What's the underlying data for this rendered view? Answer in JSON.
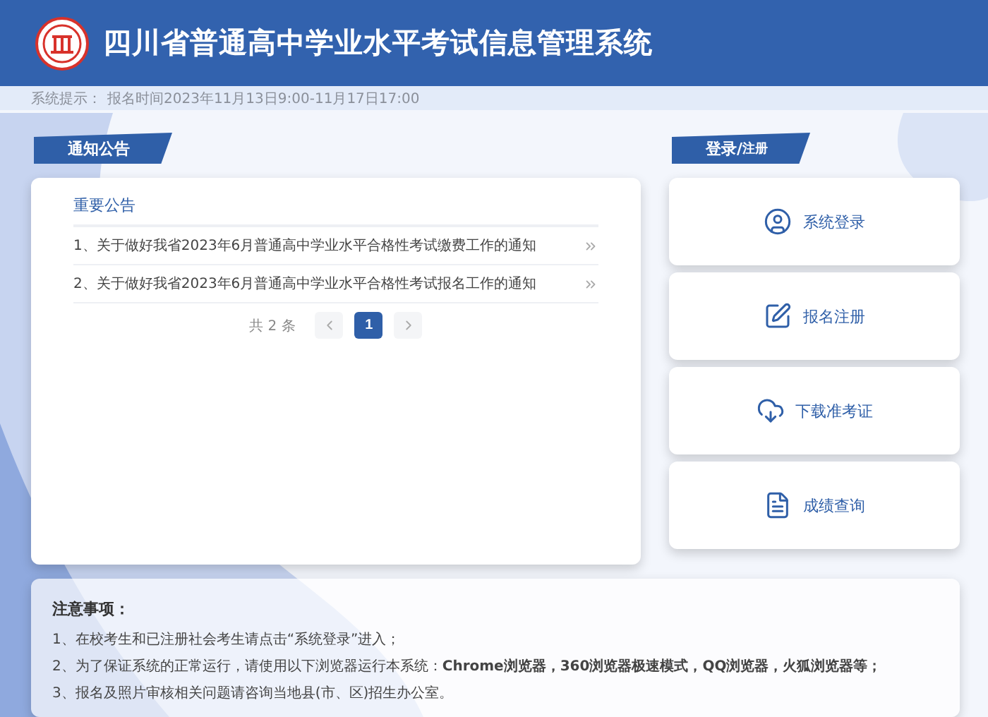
{
  "header": {
    "title": "四川省普通高中学业水平考试信息管理系统"
  },
  "notice_bar": {
    "label": "系统提示：",
    "text": "报名时间2023年11月13日9:00-11月17日17:00"
  },
  "announcements": {
    "ribbon": "通知公告",
    "heading": "重要公告",
    "items": [
      {
        "text": "1、关于做好我省2023年6月普通高中学业水平合格性考试缴费工作的通知"
      },
      {
        "text": "2、关于做好我省2023年6月普通高中学业水平合格性考试报名工作的通知"
      }
    ],
    "pagination": {
      "total": "共 2 条",
      "pages": [
        {
          "label": "1",
          "selected": true
        }
      ]
    }
  },
  "login": {
    "ribbon": "登录/",
    "ribbon_sub": "注册",
    "actions": [
      {
        "kind": "user",
        "label": "系统登录"
      },
      {
        "kind": "edit",
        "label": "报名注册"
      },
      {
        "kind": "download",
        "label": "下载准考证"
      },
      {
        "kind": "grade",
        "label": "成绩查询"
      }
    ]
  },
  "notes": {
    "title": "注意事项：",
    "lines": [
      "1、在校考生和已注册社会考生请点击“系统登录”进入；",
      "2、为了保证系统的正常运行，请使用以下浏览器运行本系统：**Chrome浏览器，360浏览器极速模式，QQ浏览器，火狐浏览器等；**",
      "3、报名及照片审核相关问题请咨询当地县(市、区)招生办公室。"
    ]
  }
}
